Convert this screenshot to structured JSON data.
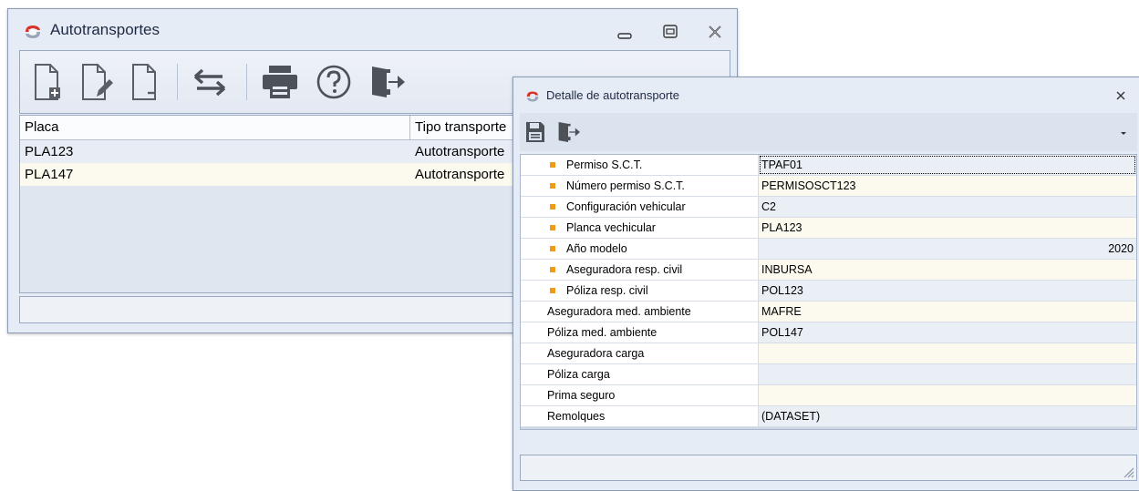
{
  "main_window": {
    "title": "Autotransportes",
    "toolbar": {
      "icons": [
        "new-document-icon",
        "edit-document-icon",
        "delete-document-icon",
        "swap-arrows-icon",
        "print-icon",
        "help-icon",
        "exit-icon"
      ]
    },
    "grid": {
      "columns": [
        "Placa",
        "Tipo transporte"
      ],
      "rows": [
        {
          "placa": "PLA123",
          "tipo": "Autotransporte"
        },
        {
          "placa": "PLA147",
          "tipo": "Autotransporte"
        }
      ]
    }
  },
  "detail_window": {
    "title": "Detalle de autotransporte",
    "toolbar": {
      "icons": [
        "save-icon",
        "exit-icon",
        "chevron-down-icon"
      ]
    },
    "properties": [
      {
        "name": "Permiso S.C.T.",
        "value": "TPAF01",
        "required": true
      },
      {
        "name": "Número permiso S.C.T.",
        "value": "PERMISOSCT123",
        "required": true
      },
      {
        "name": "Configuración vehicular",
        "value": "C2",
        "required": true
      },
      {
        "name": "Planca vechicular",
        "value": "PLA123",
        "required": true
      },
      {
        "name": "Año modelo",
        "value": "2020",
        "required": true,
        "align": "right"
      },
      {
        "name": "Aseguradora resp. civil",
        "value": "INBURSA",
        "required": true
      },
      {
        "name": "Póliza resp. civil",
        "value": "POL123",
        "required": true
      },
      {
        "name": "Aseguradora med. ambiente",
        "value": "MAFRE",
        "required": false
      },
      {
        "name": "Póliza med. ambiente",
        "value": "POL147",
        "required": false
      },
      {
        "name": "Aseguradora carga",
        "value": "",
        "required": false
      },
      {
        "name": "Póliza carga",
        "value": "",
        "required": false
      },
      {
        "name": "Prima seguro",
        "value": "",
        "required": false
      },
      {
        "name": "Remolques",
        "value": "(DATASET)",
        "required": false
      }
    ]
  },
  "colors": {
    "required_bullet": "#f09a1c",
    "window_bg": "#e6ecf5",
    "accent_red": "#d8342c"
  }
}
